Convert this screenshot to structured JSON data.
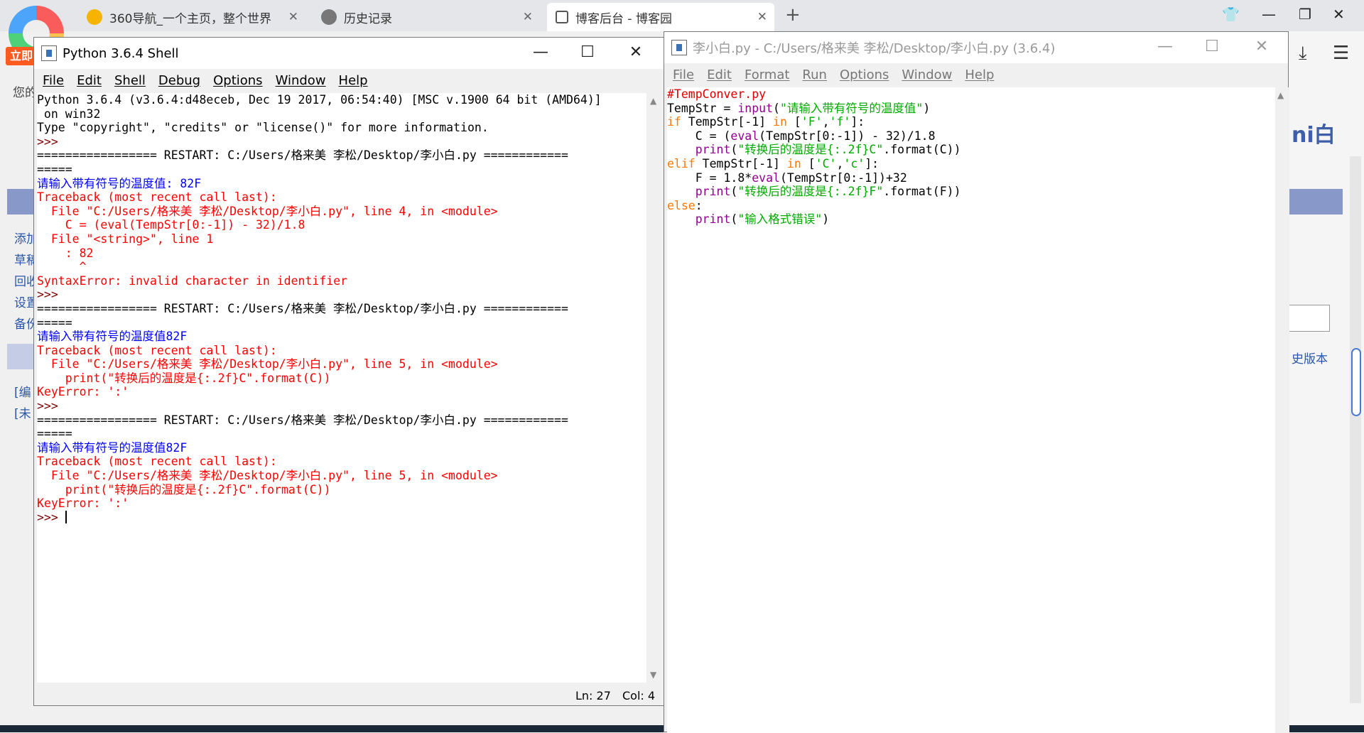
{
  "browser": {
    "tabs": [
      {
        "label": "360导航_一个主页，整个世界",
        "icon": "360-nav-icon"
      },
      {
        "label": "历史记录",
        "icon": "history-clock-icon"
      },
      {
        "label": "博客后台 - 博客园",
        "icon": "cnblogs-icon",
        "active": true
      }
    ],
    "badge": "立即",
    "greeting": "您的",
    "left_links": [
      "添加",
      "草稿",
      "回收",
      "设置",
      "备份"
    ],
    "left_links2": [
      "[编",
      "[未"
    ],
    "right_title": "ni白",
    "right_link": "史版本"
  },
  "shell": {
    "title": "Python 3.6.4 Shell",
    "menu": [
      "File",
      "Edit",
      "Shell",
      "Debug",
      "Options",
      "Window",
      "Help"
    ],
    "lines": [
      {
        "t": "Python 3.6.4 (v3.6.4:d48eceb, Dec 19 2017, 06:54:40) [MSC v.1900 64 bit (AMD64)]",
        "c": "out"
      },
      {
        "t": " on win32",
        "c": "out"
      },
      {
        "t": "Type \"copyright\", \"credits\" or \"license()\" for more information.",
        "c": "out"
      },
      {
        "t": ">>> ",
        "c": "prompt"
      },
      {
        "t": "================= RESTART: C:/Users/格来美 李松/Desktop/李小白.py ============",
        "c": "restart"
      },
      {
        "t": "=====",
        "c": "restart"
      },
      {
        "t": "请输入带有符号的温度值: 82F",
        "c": "input"
      },
      {
        "t": "Traceback (most recent call last):",
        "c": "err"
      },
      {
        "t": "  File \"C:/Users/格来美 李松/Desktop/李小白.py\", line 4, in <module>",
        "c": "err"
      },
      {
        "t": "    C = (eval(TempStr[0:-1]) - 32)/1.8",
        "c": "err"
      },
      {
        "t": "  File \"<string>\", line 1",
        "c": "err"
      },
      {
        "t": "    : 82",
        "c": "err"
      },
      {
        "t": "      ^",
        "c": "err"
      },
      {
        "t": "",
        "c": "err"
      },
      {
        "t": "SyntaxError: invalid character in identifier",
        "c": "err"
      },
      {
        "t": ">>> ",
        "c": "prompt"
      },
      {
        "t": "================= RESTART: C:/Users/格来美 李松/Desktop/李小白.py ============",
        "c": "restart"
      },
      {
        "t": "=====",
        "c": "restart"
      },
      {
        "t": "请输入带有符号的温度值82F",
        "c": "input"
      },
      {
        "t": "Traceback (most recent call last):",
        "c": "err"
      },
      {
        "t": "  File \"C:/Users/格来美 李松/Desktop/李小白.py\", line 5, in <module>",
        "c": "err"
      },
      {
        "t": "    print(\"转换后的温度是{:.2f}C\".format(C))",
        "c": "err"
      },
      {
        "t": "KeyError: ':'",
        "c": "err"
      },
      {
        "t": ">>> ",
        "c": "prompt"
      },
      {
        "t": "================= RESTART: C:/Users/格来美 李松/Desktop/李小白.py ============",
        "c": "restart"
      },
      {
        "t": "=====",
        "c": "restart"
      },
      {
        "t": "请输入带有符号的温度值82F",
        "c": "input"
      },
      {
        "t": "Traceback (most recent call last):",
        "c": "err"
      },
      {
        "t": "  File \"C:/Users/格来美 李松/Desktop/李小白.py\", line 5, in <module>",
        "c": "err"
      },
      {
        "t": "    print(\"转换后的温度是{:.2f}C\".format(C))",
        "c": "err"
      },
      {
        "t": "KeyError: ':'",
        "c": "err"
      },
      {
        "t": ">>> ",
        "c": "prompt",
        "cursor": true
      }
    ],
    "status": {
      "ln": "Ln: 27",
      "col": "Col: 4"
    }
  },
  "editor": {
    "title": "李小白.py - C:/Users/格来美 李松/Desktop/李小白.py (3.6.4)",
    "menu": [
      "File",
      "Edit",
      "Format",
      "Run",
      "Options",
      "Window",
      "Help"
    ],
    "lines": [
      [
        {
          "t": "#TempConver.py",
          "c": "comment"
        }
      ],
      [
        {
          "t": "TempStr = ",
          "c": "out"
        },
        {
          "t": "input",
          "c": "bi"
        },
        {
          "t": "(",
          "c": "out"
        },
        {
          "t": "\"请输入带有符号的温度值\"",
          "c": "str"
        },
        {
          "t": ")",
          "c": "out"
        }
      ],
      [
        {
          "t": "if",
          "c": "kw"
        },
        {
          "t": " TempStr[-1] ",
          "c": "out"
        },
        {
          "t": "in",
          "c": "kw"
        },
        {
          "t": " [",
          "c": "out"
        },
        {
          "t": "'F'",
          "c": "str"
        },
        {
          "t": ",",
          "c": "out"
        },
        {
          "t": "'f'",
          "c": "str"
        },
        {
          "t": "]:",
          "c": "out"
        }
      ],
      [
        {
          "t": "    C = (",
          "c": "out"
        },
        {
          "t": "eval",
          "c": "bi"
        },
        {
          "t": "(TempStr[0:-1]) - 32)/1.8",
          "c": "out"
        }
      ],
      [
        {
          "t": "    ",
          "c": "out"
        },
        {
          "t": "print",
          "c": "bi"
        },
        {
          "t": "(",
          "c": "out"
        },
        {
          "t": "\"转换后的温度是{:.2f}C\"",
          "c": "str"
        },
        {
          "t": ".format(C))",
          "c": "out"
        }
      ],
      [
        {
          "t": "elif",
          "c": "kw"
        },
        {
          "t": " TempStr[-1] ",
          "c": "out"
        },
        {
          "t": "in",
          "c": "kw"
        },
        {
          "t": " [",
          "c": "out"
        },
        {
          "t": "'C'",
          "c": "str"
        },
        {
          "t": ",",
          "c": "out"
        },
        {
          "t": "'c'",
          "c": "str"
        },
        {
          "t": "]:",
          "c": "out"
        }
      ],
      [
        {
          "t": "    F = 1.8*",
          "c": "out"
        },
        {
          "t": "eval",
          "c": "bi"
        },
        {
          "t": "(TempStr[0:-1])+32",
          "c": "out"
        }
      ],
      [
        {
          "t": "    ",
          "c": "out"
        },
        {
          "t": "print",
          "c": "bi"
        },
        {
          "t": "(",
          "c": "out"
        },
        {
          "t": "\"转换后的温度是{:.2f}F\"",
          "c": "str"
        },
        {
          "t": ".format(F))",
          "c": "out"
        }
      ],
      [
        {
          "t": "else",
          "c": "kw"
        },
        {
          "t": ":",
          "c": "out"
        }
      ],
      [
        {
          "t": "    ",
          "c": "out"
        },
        {
          "t": "print",
          "c": "bi"
        },
        {
          "t": "(",
          "c": "out"
        },
        {
          "t": "\"输入格式错误\"",
          "c": "str"
        },
        {
          "t": ")",
          "c": "out"
        }
      ]
    ]
  },
  "colors": {
    "prompt": "#800000",
    "input": "#0000ff",
    "error": "#ff0000",
    "keyword": "#ff7700",
    "string": "#00aa00",
    "builtin": "#900090",
    "comment": "#dd0000"
  }
}
